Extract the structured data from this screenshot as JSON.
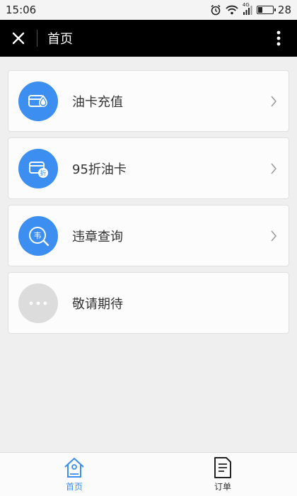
{
  "status_bar": {
    "time": "15:06",
    "network": "4G",
    "battery": "28",
    "battery_level": 0.28
  },
  "header": {
    "title": "首页",
    "close_icon": "close-icon",
    "more_icon": "more-vertical-icon"
  },
  "menu": {
    "items": [
      {
        "label": "油卡充值",
        "icon": "fuel-card-drop-icon",
        "color": "#3c8ff0",
        "has_chevron": true
      },
      {
        "label": "95折油卡",
        "icon": "discount-card-icon",
        "color": "#3c8ff0",
        "has_chevron": true
      },
      {
        "label": "违章查询",
        "icon": "violation-search-icon",
        "color": "#3c8ff0",
        "has_chevron": true
      },
      {
        "label": "敬请期待",
        "icon": "ellipsis-icon",
        "color": "#dcdcdc",
        "has_chevron": false
      }
    ]
  },
  "bottom_nav": {
    "items": [
      {
        "label": "首页",
        "icon": "home-icon",
        "active": true
      },
      {
        "label": "订单",
        "icon": "order-document-icon",
        "active": false
      }
    ]
  },
  "colors": {
    "accent": "#3c8ff0",
    "title_bar": "#000000",
    "background": "#efefef"
  }
}
